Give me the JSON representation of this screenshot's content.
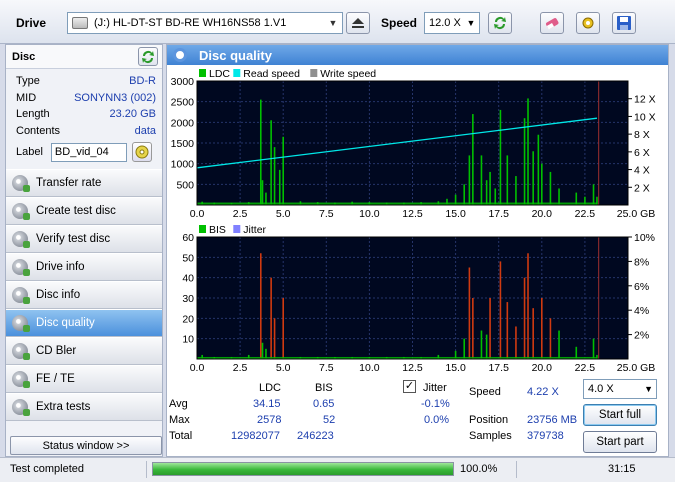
{
  "toolbar": {
    "drive_label": "Drive",
    "drive_value": "(J:)  HL-DT-ST BD-RE  WH16NS58 1.V1",
    "speed_label": "Speed",
    "speed_value": "12.0 X"
  },
  "disc": {
    "header": "Disc",
    "rows": [
      {
        "key": "Type",
        "value": "BD-R"
      },
      {
        "key": "MID",
        "value": "SONYNN3 (002)"
      },
      {
        "key": "Length",
        "value": "23.20 GB"
      },
      {
        "key": "Contents",
        "value": "data"
      }
    ],
    "label_key": "Label",
    "label_value": "BD_vid_04"
  },
  "nav": [
    {
      "label": "Transfer rate",
      "active": false
    },
    {
      "label": "Create test disc",
      "active": false
    },
    {
      "label": "Verify test disc",
      "active": false
    },
    {
      "label": "Drive info",
      "active": false
    },
    {
      "label": "Disc info",
      "active": false
    },
    {
      "label": "Disc quality",
      "active": true
    },
    {
      "label": "CD Bler",
      "active": false
    },
    {
      "label": "FE / TE",
      "active": false
    },
    {
      "label": "Extra tests",
      "active": false
    }
  ],
  "status_window_button": "Status window >>",
  "main_title": "Disc quality",
  "chart_data": [
    {
      "type": "area",
      "legend": [
        "LDC",
        "Read speed",
        "Write speed"
      ],
      "colors": {
        "LDC": "#00c000",
        "Read speed": "#00e8e8",
        "Write speed": "#909090"
      },
      "x_ticks": [
        "0.0",
        "2.5",
        "5.0",
        "7.5",
        "10.0",
        "12.5",
        "15.0",
        "17.5",
        "20.0",
        "22.5",
        "25.0 GB"
      ],
      "xlim": [
        0,
        25
      ],
      "ylim": [
        0,
        3000
      ],
      "y_ticks": [
        "3000",
        "2500",
        "2000",
        "1500",
        "1000",
        "500"
      ],
      "y2_ticks": [
        "12 X",
        "10 X",
        "8 X",
        "6 X",
        "4 X",
        "2 X"
      ],
      "y2lim": [
        0,
        14
      ],
      "series": [
        {
          "name": "LDC",
          "x": [
            0.3,
            1,
            2,
            3,
            3.7,
            3.8,
            4,
            4.3,
            4.5,
            4.8,
            5,
            6,
            7,
            8,
            9,
            10,
            11,
            12,
            13,
            14,
            14.5,
            15,
            15.5,
            15.8,
            16,
            16.5,
            16.8,
            17,
            17.3,
            17.6,
            18,
            18.5,
            19,
            19.2,
            19.5,
            19.8,
            20,
            20.5,
            21,
            22,
            22.5,
            23,
            23.2
          ],
          "y": [
            80,
            60,
            50,
            70,
            2550,
            600,
            300,
            2050,
            1400,
            850,
            1650,
            90,
            70,
            60,
            80,
            70,
            60,
            60,
            70,
            90,
            150,
            250,
            500,
            1200,
            2200,
            1200,
            600,
            800,
            400,
            2300,
            1200,
            700,
            2100,
            2578,
            1300,
            1700,
            1000,
            800,
            400,
            300,
            200,
            500,
            200
          ]
        },
        {
          "name": "Read speed",
          "x": [
            0,
            23.2
          ],
          "y": [
            4.2,
            9.8
          ]
        }
      ]
    },
    {
      "type": "area",
      "legend": [
        "BIS",
        "Jitter"
      ],
      "colors": {
        "BIS": "#00c000",
        "Jitter": "#8080ff"
      },
      "x_ticks": [
        "0.0",
        "2.5",
        "5.0",
        "7.5",
        "10.0",
        "12.5",
        "15.0",
        "17.5",
        "20.0",
        "22.5",
        "25.0 GB"
      ],
      "xlim": [
        0,
        25
      ],
      "ylim": [
        0,
        60
      ],
      "y_ticks": [
        "60",
        "50",
        "40",
        "30",
        "20",
        "10"
      ],
      "y2_ticks": [
        "10%",
        "8%",
        "6%",
        "4%",
        "2%"
      ],
      "y2lim": [
        0,
        10
      ],
      "series": [
        {
          "name": "BIS",
          "x": [
            0.3,
            1,
            2,
            3,
            3.7,
            3.8,
            4,
            4.3,
            4.5,
            5,
            6,
            7,
            8,
            9,
            10,
            11,
            12,
            13,
            14,
            15,
            15.5,
            15.8,
            16,
            16.5,
            16.8,
            17,
            17.6,
            18,
            18.5,
            19,
            19.2,
            19.5,
            20,
            20.5,
            21,
            22,
            23,
            23.2
          ],
          "y": [
            2,
            1,
            1,
            2,
            52,
            8,
            5,
            40,
            20,
            30,
            1,
            1,
            1,
            1,
            1,
            1,
            1,
            1,
            2,
            4,
            10,
            45,
            30,
            14,
            12,
            30,
            48,
            28,
            16,
            40,
            52,
            25,
            30,
            20,
            14,
            6,
            10,
            2
          ]
        }
      ]
    }
  ],
  "stats": {
    "col_ldc": "LDC",
    "col_bis": "BIS",
    "rows": [
      {
        "label": "Avg",
        "ldc": "34.15",
        "bis": "0.65",
        "jitter": "-0.1%"
      },
      {
        "label": "Max",
        "ldc": "2578",
        "bis": "52",
        "jitter": "0.0%"
      },
      {
        "label": "Total",
        "ldc": "12982077",
        "bis": "246223",
        "jitter": ""
      }
    ],
    "jitter_label": "Jitter",
    "jitter_checked": true,
    "speed_label": "Speed",
    "speed_value": "4.22 X",
    "position_label": "Position",
    "position_value": "23756 MB",
    "samples_label": "Samples",
    "samples_value": "379738",
    "test_speed": "4.0 X",
    "start_full": "Start full",
    "start_part": "Start part"
  },
  "statusbar": {
    "text": "Test completed",
    "progress": 1.0,
    "percent": "100.0%",
    "time": "31:15"
  }
}
